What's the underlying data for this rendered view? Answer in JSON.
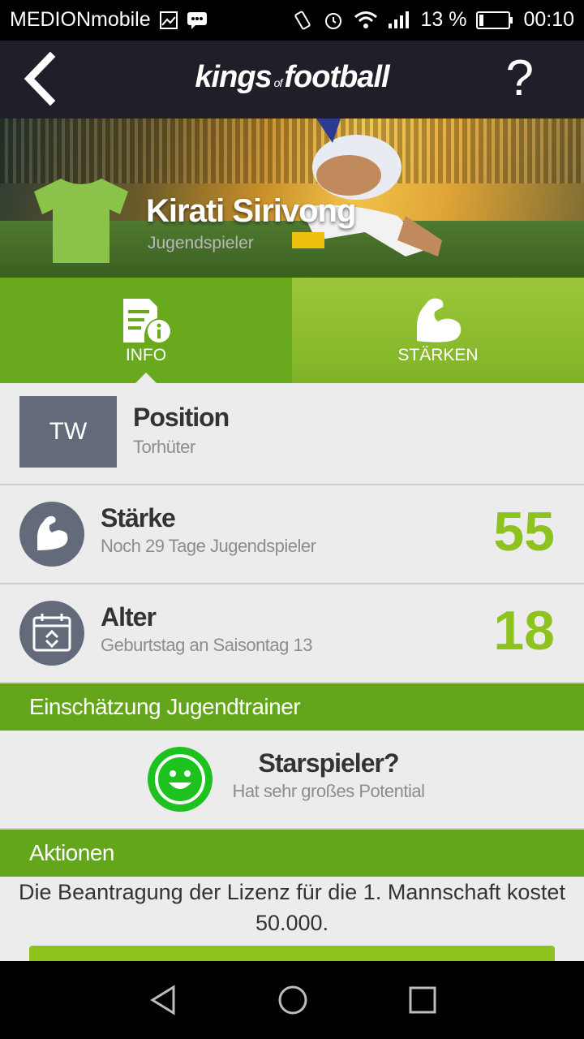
{
  "status_bar": {
    "carrier": "MEDIONmobile",
    "battery": "13 %",
    "time": "00:10"
  },
  "header": {
    "logo_main1": "kings",
    "logo_of": "of",
    "logo_main2": "football",
    "help_label": "?"
  },
  "player": {
    "name": "Kirati Sirivong",
    "role": "Jugendspieler"
  },
  "tabs": [
    {
      "label": "INFO",
      "icon": "info-document-icon",
      "active": true
    },
    {
      "label": "STÄRKEN",
      "icon": "biceps-icon",
      "active": false
    }
  ],
  "rows": {
    "position": {
      "badge": "TW",
      "title": "Position",
      "subtitle": "Torhüter"
    },
    "strength": {
      "title": "Stärke",
      "subtitle": "Noch 29 Tage Jugendspieler",
      "value": "55",
      "icon": "biceps-icon"
    },
    "age": {
      "title": "Alter",
      "subtitle": "Geburtstag an Saisontag 13",
      "value": "18",
      "icon": "calendar-icon"
    }
  },
  "assessment": {
    "section_title": "Einschätzung Jugendtrainer",
    "title": "Starspieler?",
    "subtitle": "Hat sehr großes Potential",
    "icon": "smiley-icon"
  },
  "actions": {
    "section_title": "Aktionen",
    "text": "Die Beantragung der Lizenz für die 1. Mannschaft kostet 50.000."
  },
  "colors": {
    "accent_green": "#8dc21f",
    "section_green": "#64a61b",
    "header_bg": "#211e2a",
    "badge_grey": "#636b7a"
  }
}
